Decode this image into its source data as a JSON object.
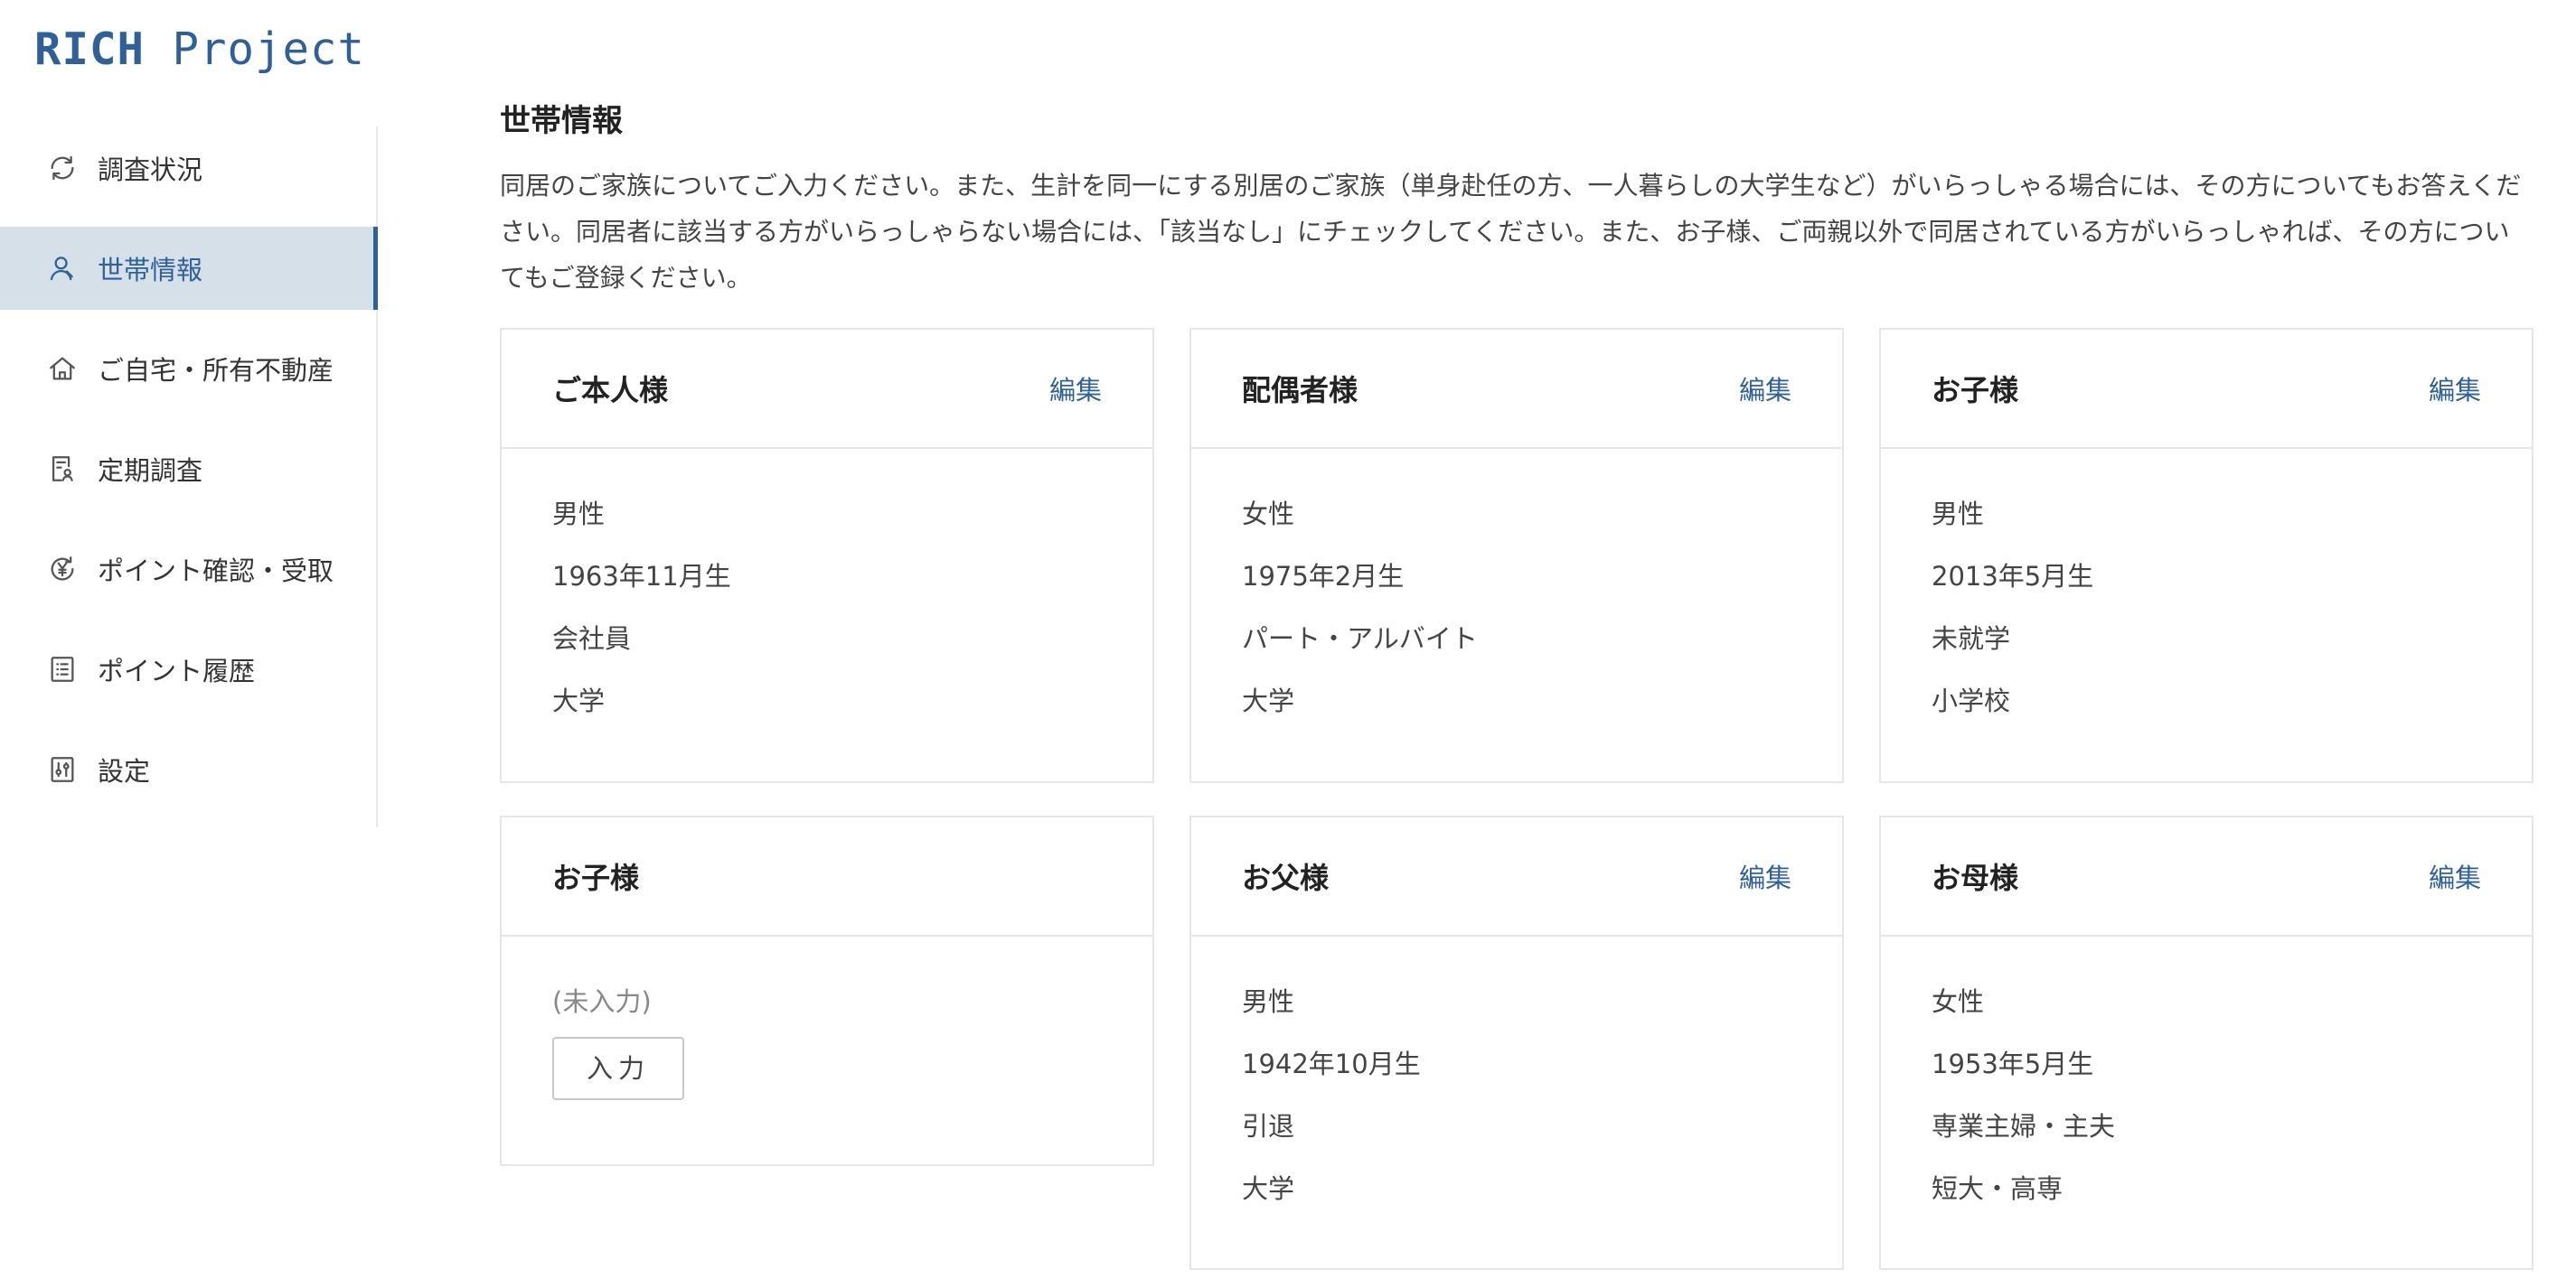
{
  "app": {
    "logo_bold": "RICH",
    "logo_rest": "Project"
  },
  "colors": {
    "accent": "#2f6097",
    "active_bg": "#d6e0e8"
  },
  "sidebar": {
    "items": [
      {
        "label": "調査状況",
        "icon": "refresh-icon",
        "active": false
      },
      {
        "label": "世帯情報",
        "icon": "user-icon",
        "active": true
      },
      {
        "label": "ご自宅・所有不動産",
        "icon": "home-icon",
        "active": false
      },
      {
        "label": "定期調査",
        "icon": "survey-icon",
        "active": false
      },
      {
        "label": "ポイント確認・受取",
        "icon": "yen-icon",
        "active": false
      },
      {
        "label": "ポイント履歴",
        "icon": "list-icon",
        "active": false
      },
      {
        "label": "設定",
        "icon": "settings-icon",
        "active": false
      }
    ]
  },
  "main": {
    "title": "世帯情報",
    "description": "同居のご家族についてご入力ください。また、生計を同一にする別居のご家族（単身赴任の方、一人暮らしの大学生など）がいらっしゃる場合には、その方についてもお答えください。同居者に該当する方がいらっしゃらない場合には、「該当なし」にチェックしてください。また、お子様、ご両親以外で同居されている方がいらっしゃれば、その方についてもご登録ください。",
    "edit_label": "編集",
    "cards": [
      {
        "title": "ご本人様",
        "gender": "男性",
        "birth": "1963年11月生",
        "job": "会社員",
        "education": "大学"
      },
      {
        "title": "配偶者様",
        "gender": "女性",
        "birth": "1975年2月生",
        "job": "パート・アルバイト",
        "education": "大学"
      },
      {
        "title": "お子様",
        "gender": "男性",
        "birth": "2013年5月生",
        "job": "未就学",
        "education": "小学校"
      },
      {
        "title": "お子様",
        "empty_note": "(未入力)",
        "input_label": "入力"
      },
      {
        "title": "お父様",
        "gender": "男性",
        "birth": "1942年10月生",
        "job": "引退",
        "education": "大学"
      },
      {
        "title": "お母様",
        "gender": "女性",
        "birth": "1953年5月生",
        "job": "専業主婦・主夫",
        "education": "短大・高専"
      }
    ]
  }
}
